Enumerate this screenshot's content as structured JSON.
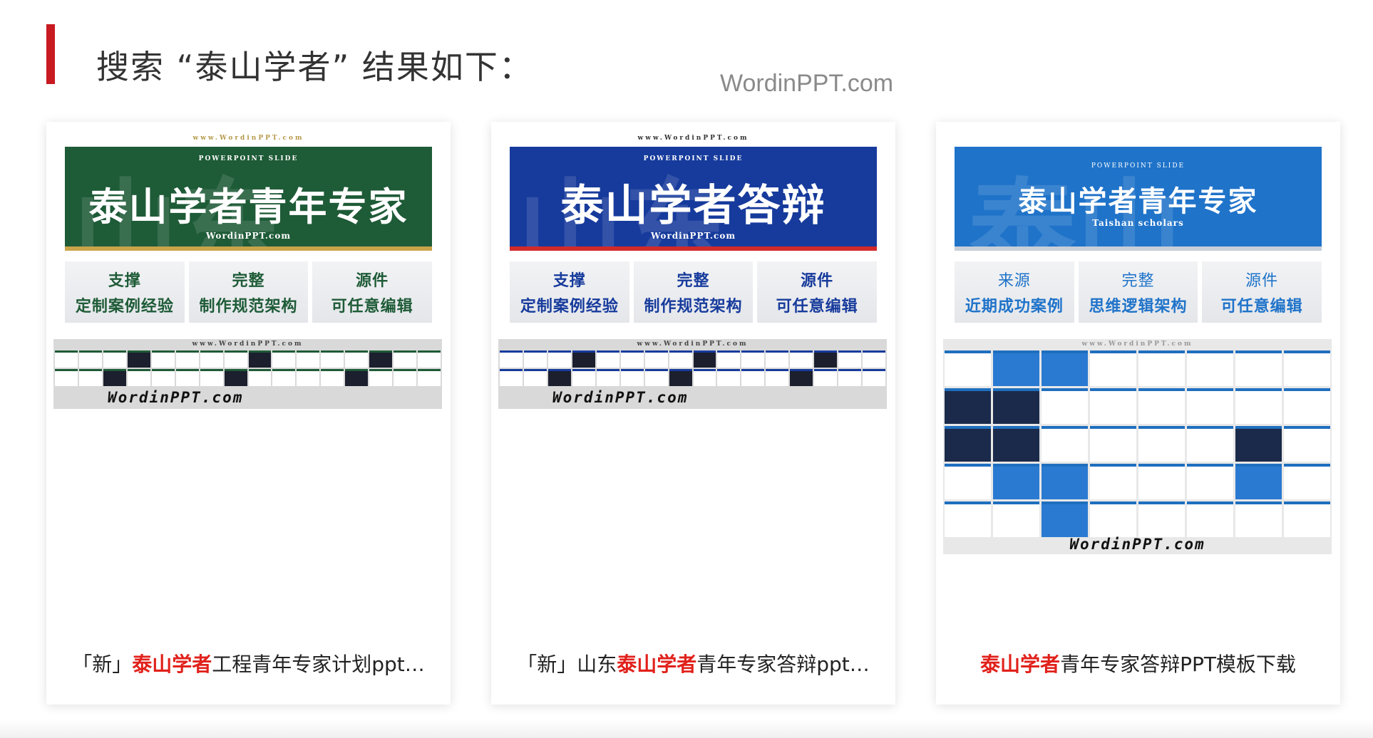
{
  "header": {
    "title": "搜索 “泰山学者” 结果如下：",
    "watermark": "WordinPPT.com"
  },
  "cards": [
    {
      "site": "www.WordinPPT.com",
      "banner": {
        "small": "POWERPOINT SLIDE",
        "title": "泰山学者青年专家",
        "sub": "WordinPPT.com",
        "bg_chars": "山东",
        "bg": "#1e5b37",
        "stripe": "#c9a44a"
      },
      "features": [
        {
          "line1": "支撑",
          "line2": "定制案例经验"
        },
        {
          "line1": "完整",
          "line2": "制作规范架构"
        },
        {
          "line1": "源件",
          "line2": "可任意编辑"
        }
      ],
      "feature_color": "#1e5b37",
      "strip_site": "www.WordinPPT.com",
      "strip_mark": "WordinPPT.com",
      "caption": {
        "pre": "「新」",
        "hl": "泰山学者",
        "post": "工程青年专家计划ppt…"
      }
    },
    {
      "site": "www.WordinPPT.com",
      "banner": {
        "small": "POWERPOINT SLIDE",
        "title": "泰山学者答辩",
        "sub": "WordinPPT.com",
        "bg_chars": "山东",
        "bg": "#173b9c",
        "stripe": "#d22a2a"
      },
      "features": [
        {
          "line1": "支撑",
          "line2": "定制案例经验"
        },
        {
          "line1": "完整",
          "line2": "制作规范架构"
        },
        {
          "line1": "源件",
          "line2": "可任意编辑"
        }
      ],
      "feature_color": "#173b9c",
      "strip_site": "www.WordinPPT.com",
      "strip_mark": "WordinPPT.com",
      "caption": {
        "pre": "「新」山东",
        "hl": "泰山学者",
        "post": "青年专家答辩ppt…"
      }
    },
    {
      "site": "",
      "banner": {
        "small": "POWERPOINT SLIDE",
        "title": "泰山学者青年专家",
        "sub": "Taishan scholars",
        "bg_chars": "泰山",
        "bg": "#1f73c9",
        "stripe": "#c9cfd8"
      },
      "features": [
        {
          "line1": "来源",
          "line2": "近期成功案例"
        },
        {
          "line1": "完整",
          "line2": "思维逻辑架构"
        },
        {
          "line1": "源件",
          "line2": "可任意编辑"
        }
      ],
      "feature_color": "#1f73c9",
      "strip_site": "www.WordinPPT.com",
      "strip_mark": "WordinPPT.com",
      "caption": {
        "pre": "",
        "hl": "泰山学者",
        "post": "青年专家答辩PPT模板下载"
      }
    }
  ]
}
